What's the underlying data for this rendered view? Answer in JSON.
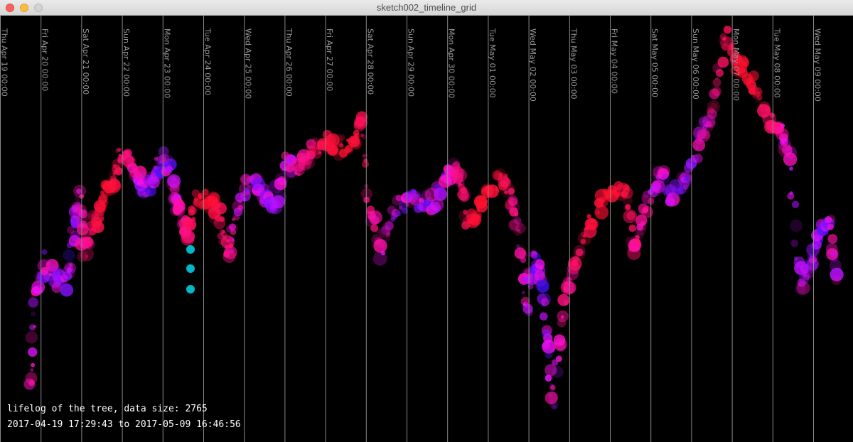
{
  "window": {
    "title": "sketch002_timeline_grid",
    "buttons": [
      "close-icon",
      "minimize-icon",
      "maximize-icon"
    ]
  },
  "info": {
    "line1": "lifelog of the tree, data size: 2765",
    "line2": "2017-04-19 17:29:43 to 2017-05-09 16:46:56"
  },
  "grid": {
    "labels": [
      "Thu Apr 19 00:00",
      "Fri Apr 20 00:00",
      "Sat Apr 21 00:00",
      "Sun Apr 22 00:00",
      "Mon Apr 23 00:00",
      "Tue Apr 24 00:00",
      "Wed Apr 25 00:00",
      "Thu Apr 26 00:00",
      "Fri Apr 27 00:00",
      "Sat Apr 28 00:00",
      "Sun Apr 29 00:00",
      "Mon Apr 30 00:00",
      "Tue May 01 00:00",
      "Wed May 02 00:00",
      "Thu May 03 00:00",
      "Fri May 04 00:00",
      "Sat May 05 00:00",
      "Sun May 06 00:00",
      "Mon May 07 00:00",
      "Tue May 08 00:00",
      "Wed May 09 00:00"
    ]
  },
  "colors": {
    "background": "#000000",
    "gridline": "#8a8a8a",
    "label": "#9a9a9a",
    "red": "#ff1030",
    "magenta": "#ff20e0",
    "blue": "#3010ff",
    "cyan": "#00b8c8"
  }
}
